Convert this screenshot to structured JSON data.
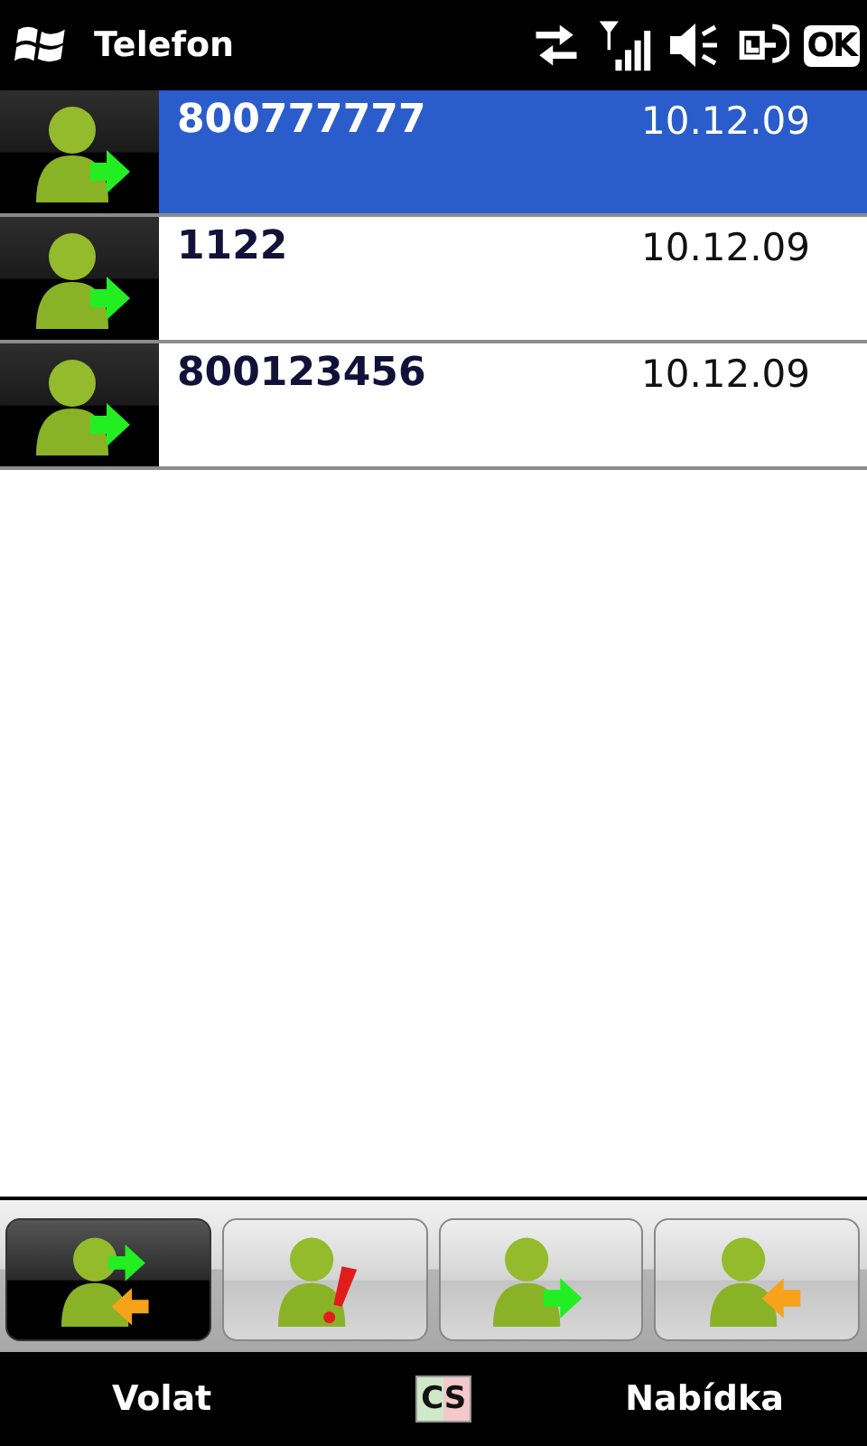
{
  "title_bar": {
    "title": "Telefon",
    "ok": "OK"
  },
  "calls": [
    {
      "kind": "outgoing",
      "number": "800777777",
      "date": "10.12.09",
      "selected": true
    },
    {
      "kind": "outgoing",
      "number": "1122",
      "date": "10.12.09",
      "selected": false
    },
    {
      "kind": "outgoing",
      "number": "800123456",
      "date": "10.12.09",
      "selected": false
    }
  ],
  "filter_tabs": [
    {
      "kind": "all",
      "selected": true
    },
    {
      "kind": "missed",
      "selected": false
    },
    {
      "kind": "outgoing",
      "selected": false
    },
    {
      "kind": "incoming",
      "selected": false
    }
  ],
  "soft_keys": {
    "left": "Volat",
    "input_mode": "CS",
    "right": "Nabídka"
  }
}
